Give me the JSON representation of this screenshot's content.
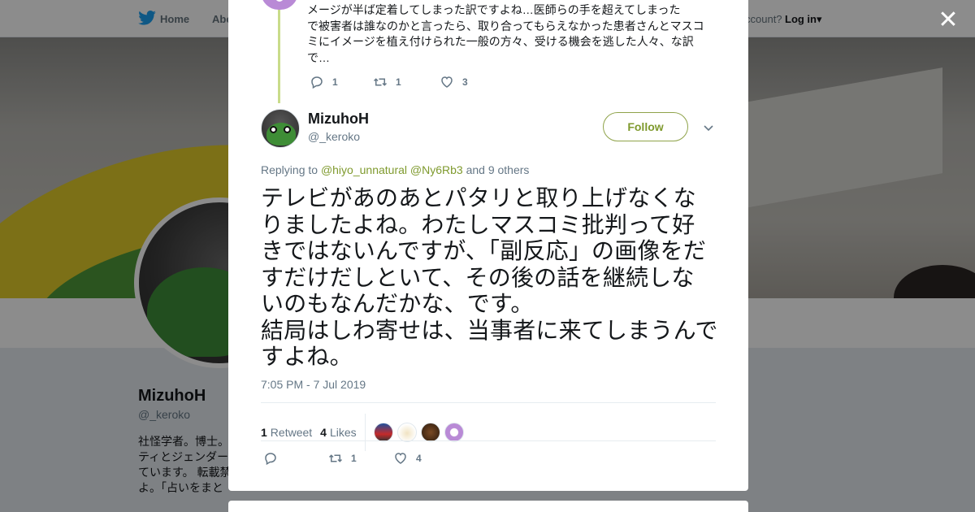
{
  "topbar": {
    "home_label": "Home",
    "about_label": "Abo",
    "account_text": "ccount?",
    "login_label": "Log in"
  },
  "profile": {
    "name": "MizuhoH",
    "handle": "@_keroko",
    "bio_lines": [
      "社怪学者。博士。",
      "ティとジェンダー",
      "ています。 転載禁",
      "よ。「占いをまと"
    ]
  },
  "modal": {
    "close_icon": "close-icon",
    "previous_tweet": {
      "text_lines": [
        "メージが半ば定着してしまった訳ですよね…医師らの手を超えてしまった",
        "で被害者は誰なのかと言ったら、取り合ってもらえなかった患者さんとマスコ",
        "ミにイメージを植え付けられた一般の方々、受ける機会を逃した人々、な訳",
        "で…"
      ],
      "replies": "1",
      "retweets": "1",
      "likes": "3"
    },
    "tweet": {
      "name": "MizuhoH",
      "handle": "@_keroko",
      "follow_label": "Follow",
      "replying_prefix": "Replying to",
      "mention_1": "@hiyo_unnatural",
      "mention_2": "@Ny6Rb3",
      "replying_suffix": "and 9 others",
      "text_lines": [
        "テレビがあのあとパタリと取り上げなくな",
        "りましたよね。わたしマスコミ批判って好",
        "きではないんですが、「副反応」の画像をだ",
        "すだけだしといて、その後の話を継続しな",
        "いのもなんだかな、です。",
        "結局はしわ寄せは、当事者に来てしまうんで",
        "すよね。"
      ],
      "timestamp": "7:05 PM - 7 Jul 2019",
      "retweet_count": "1",
      "retweet_label": "Retweet",
      "likes_count": "4",
      "likes_label": "Likes",
      "action_retweets": "1",
      "action_likes": "4"
    }
  },
  "colors": {
    "accent": "#7f9a2e",
    "text": "#14171a",
    "muted": "#657786"
  }
}
